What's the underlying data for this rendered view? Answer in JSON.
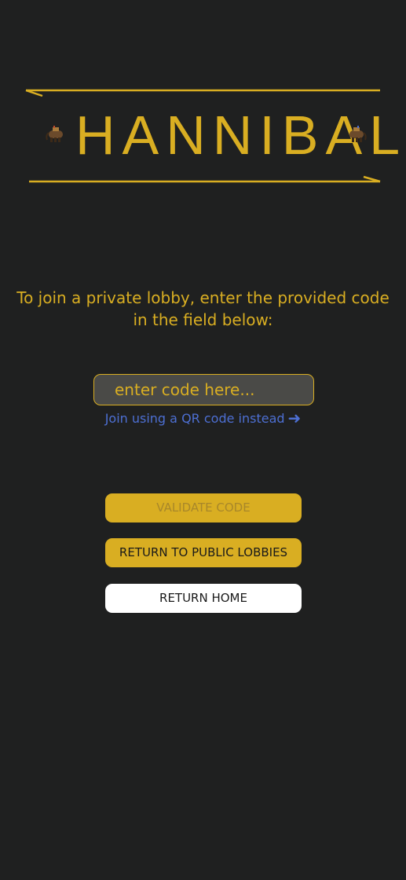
{
  "logo": {
    "title": "HANNIBAL",
    "icon_left": "elephant-icon",
    "icon_right": "elephant-icon"
  },
  "instructions": "To join a private lobby, enter the provided code in the field below:",
  "code_field": {
    "value": "",
    "placeholder": "enter code here..."
  },
  "qr_link": {
    "label": "Join using a QR code instead",
    "icon": "arrow-right-icon",
    "arrow": "➜"
  },
  "buttons": {
    "validate": "VALIDATE CODE",
    "public_lobbies": "RETURN TO PUBLIC LOBBIES",
    "home": "RETURN HOME"
  },
  "colors": {
    "background": "#1f2020",
    "accent": "#d9ae22",
    "link": "#4d6fd3",
    "white_button": "#ffffff"
  }
}
